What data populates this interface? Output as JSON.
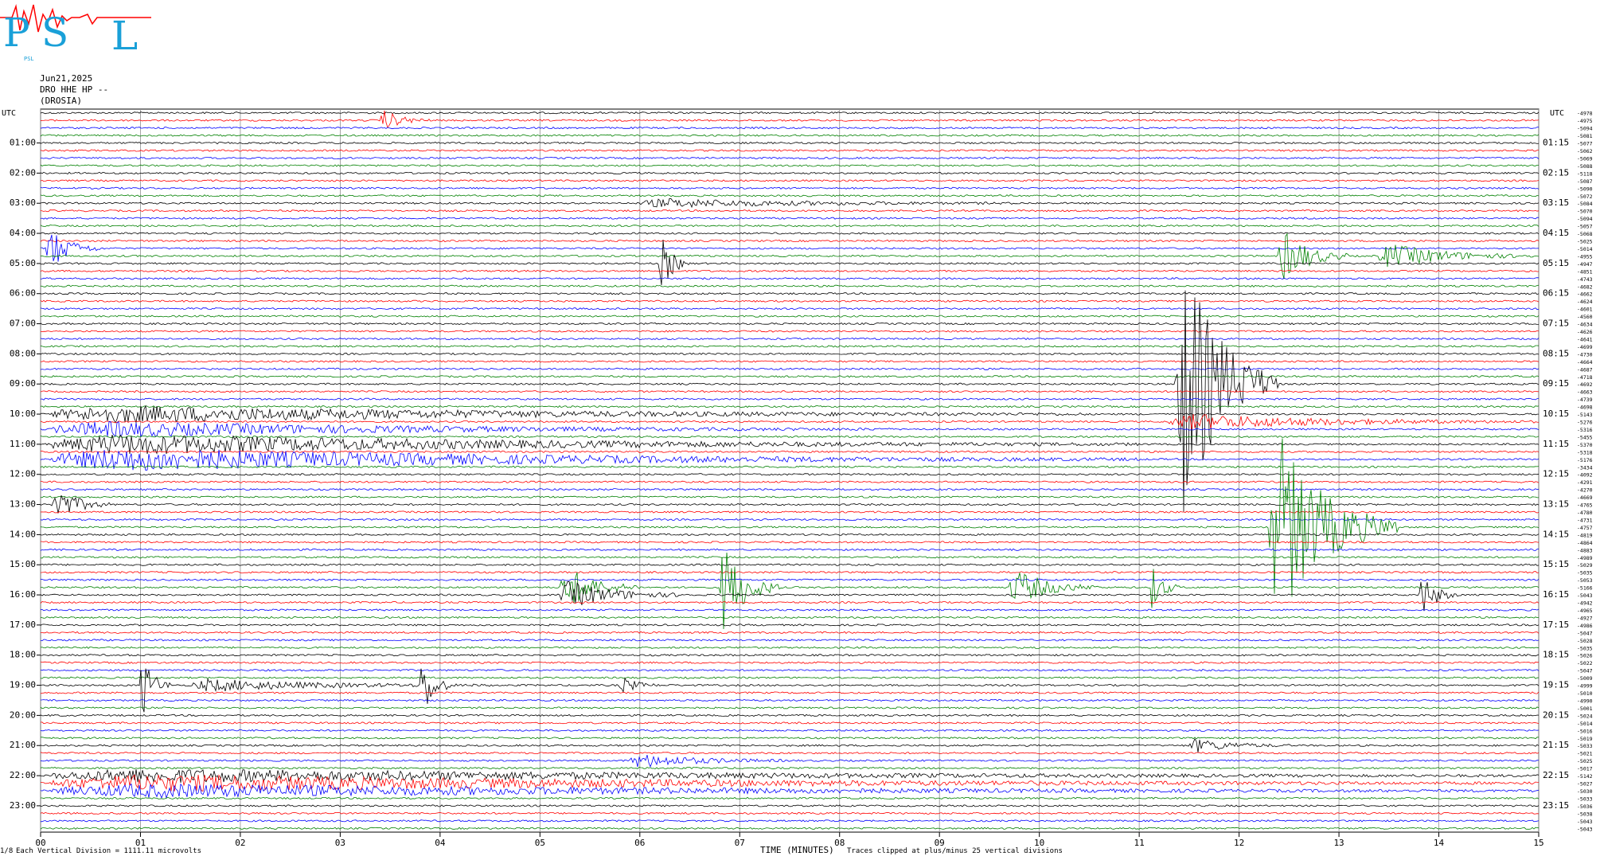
{
  "header": {
    "date": "Jun21,2025",
    "station": "DRO HHE HP --",
    "site": "(DROSIA)",
    "logo_text": "PSL"
  },
  "footer": {
    "division": "Each Vertical Division = 1111.11 microvolts",
    "clip": "Traces clipped at plus/minus 25 vertical divisions",
    "corner": "1/8"
  },
  "chart_data": {
    "type": "line",
    "title": "",
    "xlabel": "TIME (MINUTES)",
    "ylabel_left": "UTC",
    "ylabel_right": "UTC",
    "xlim": [
      0,
      15
    ],
    "x_ticks": [
      "00",
      "01",
      "02",
      "03",
      "04",
      "05",
      "06",
      "07",
      "08",
      "09",
      "10",
      "11",
      "12",
      "13",
      "14",
      "15"
    ],
    "rows_per_hour": 4,
    "hours": 24,
    "left_labels": [
      "01:00",
      "02:00",
      "03:00",
      "04:00",
      "05:00",
      "06:00",
      "07:00",
      "08:00",
      "09:00",
      "10:00",
      "11:00",
      "12:00",
      "13:00",
      "14:00",
      "15:00",
      "16:00",
      "17:00",
      "18:00",
      "19:00",
      "20:00",
      "21:00",
      "22:00",
      "23:00"
    ],
    "right_labels": [
      "01:15",
      "02:15",
      "03:15",
      "04:15",
      "05:15",
      "06:15",
      "07:15",
      "08:15",
      "09:15",
      "10:15",
      "11:15",
      "12:15",
      "13:15",
      "14:15",
      "15:15",
      "16:15",
      "17:15",
      "18:15",
      "19:15",
      "20:15",
      "21:15",
      "22:15",
      "23:15"
    ],
    "trace_colors": [
      "#000000",
      "#ff0000",
      "#0000ff",
      "#008000"
    ],
    "row_offsets": [
      "-4978",
      "-4975",
      "-5094",
      "-5081",
      "-5077",
      "-5062",
      "-5069",
      "-5088",
      "-5118",
      "-5087",
      "-5090",
      "-5072",
      "-5084",
      "-5070",
      "-5094",
      "-5057",
      "-5068",
      "-5025",
      "-5014",
      "-4955",
      "-4947",
      "-4851",
      "-4743",
      "-4682",
      "-4662",
      "-4624",
      "-4601",
      "-4560",
      "-4634",
      "-4626",
      "-4641",
      "-4699",
      "-4730",
      "-4664",
      "-4687",
      "-4718",
      "-4692",
      "-4663",
      "-4739",
      "-4698",
      "-5143",
      "-5276",
      "-5316",
      "-5455",
      "-5370",
      "-5318",
      "-5176",
      "-3434",
      "-4092",
      "-4291",
      "-4270",
      "-4669",
      "-4765",
      "-4780",
      "-4731",
      "-4757",
      "-4819",
      "-4864",
      "-4883",
      "-4989",
      "-5029",
      "-5035",
      "-5053",
      "-5166",
      "-5043",
      "-4942",
      "-4965",
      "-4927",
      "-4986",
      "-5047",
      "-5028",
      "-5035",
      "-5026",
      "-5022",
      "-5047",
      "-5009",
      "-4999",
      "-5010",
      "-4990",
      "-5001",
      "-5024",
      "-5014",
      "-5016",
      "-5019",
      "-5033",
      "-5021",
      "-5025",
      "-5017",
      "-5142",
      "-5027",
      "-5030",
      "-5033",
      "-5036",
      "-5038",
      "-5043",
      "-5043"
    ],
    "events": [
      {
        "row": 1,
        "t0": 3.4,
        "t1": 3.9,
        "amp": 12
      },
      {
        "row": 12,
        "t0": 6.0,
        "t1": 9.8,
        "amp": 5
      },
      {
        "row": 18,
        "t0": 0.05,
        "t1": 0.6,
        "amp": 26
      },
      {
        "row": 20,
        "t0": 6.2,
        "t1": 6.5,
        "amp": 34
      },
      {
        "row": 19,
        "t0": 12.4,
        "t1": 13.1,
        "amp": 32
      },
      {
        "row": 19,
        "t0": 13.4,
        "t1": 15.0,
        "amp": 14
      },
      {
        "row": 40,
        "t0": 0.1,
        "t1": 10.5,
        "amp": 10
      },
      {
        "row": 42,
        "t0": 0.1,
        "t1": 8.5,
        "amp": 9
      },
      {
        "row": 44,
        "t0": 0.1,
        "t1": 11.0,
        "amp": 12
      },
      {
        "row": 46,
        "t0": 0.1,
        "t1": 11.0,
        "amp": 14
      },
      {
        "row": 41,
        "t0": 11.3,
        "t1": 15.0,
        "amp": 9
      },
      {
        "row": 36,
        "t0": 11.35,
        "t1": 12.4,
        "amp": 170
      },
      {
        "row": 52,
        "t0": 0.1,
        "t1": 0.7,
        "amp": 22
      },
      {
        "row": 55,
        "t0": 12.3,
        "t1": 13.6,
        "amp": 120
      },
      {
        "row": 63,
        "t0": 5.2,
        "t1": 6.0,
        "amp": 28
      },
      {
        "row": 64,
        "t0": 5.2,
        "t1": 6.5,
        "amp": 16
      },
      {
        "row": 63,
        "t0": 6.8,
        "t1": 7.4,
        "amp": 55
      },
      {
        "row": 63,
        "t0": 11.1,
        "t1": 11.4,
        "amp": 30
      },
      {
        "row": 63,
        "t0": 9.7,
        "t1": 10.6,
        "amp": 22
      },
      {
        "row": 64,
        "t0": 13.8,
        "t1": 14.2,
        "amp": 26
      },
      {
        "row": 76,
        "t0": 1.0,
        "t1": 1.3,
        "amp": 40
      },
      {
        "row": 76,
        "t0": 3.8,
        "t1": 4.1,
        "amp": 42
      },
      {
        "row": 76,
        "t0": 1.5,
        "t1": 4.5,
        "amp": 7
      },
      {
        "row": 76,
        "t0": 5.8,
        "t1": 6.2,
        "amp": 10
      },
      {
        "row": 84,
        "t0": 11.5,
        "t1": 12.5,
        "amp": 8
      },
      {
        "row": 86,
        "t0": 5.9,
        "t1": 7.5,
        "amp": 8
      },
      {
        "row": 88,
        "t0": 0.1,
        "t1": 15.0,
        "amp": 8
      },
      {
        "row": 89,
        "t0": 0.1,
        "t1": 15.0,
        "amp": 10
      },
      {
        "row": 90,
        "t0": 0.1,
        "t1": 15.0,
        "amp": 8
      }
    ]
  }
}
